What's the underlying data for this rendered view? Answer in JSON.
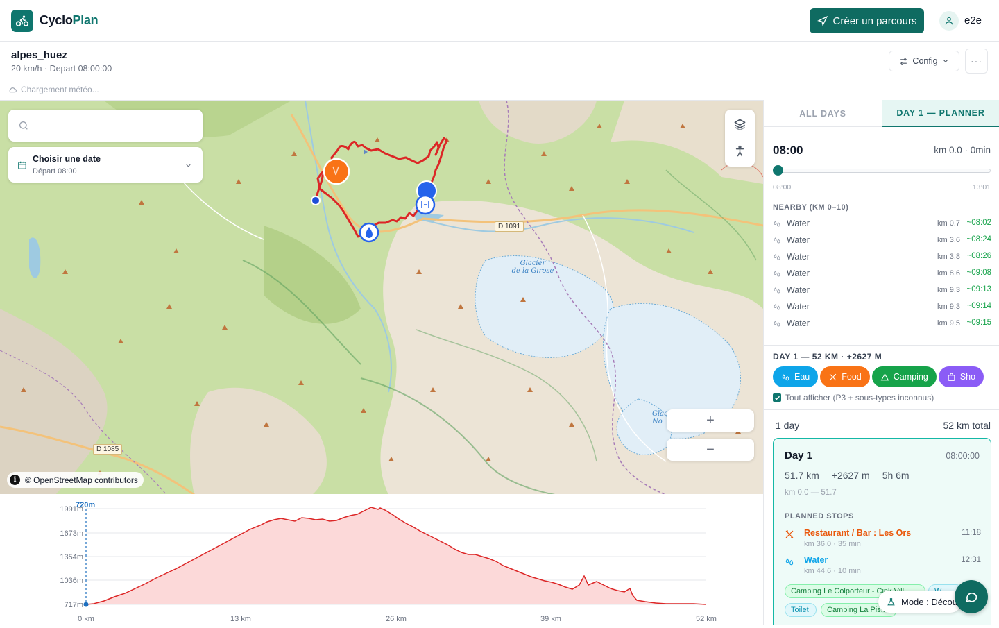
{
  "app": {
    "brand_part1": "Cyclo",
    "brand_part2": "Plan",
    "create_label": "Créer un parcours",
    "username": "e2e"
  },
  "route": {
    "name": "alpes_huez",
    "subtitle": "20 km/h · Depart 08:00:00",
    "weather_status": "Chargement météo...",
    "config_label": "Config",
    "more_label": "···"
  },
  "map": {
    "search_placeholder": "",
    "date_title": "Choisir une date",
    "date_sub": "Départ 08:00",
    "zoom_in": "+",
    "zoom_out": "−",
    "attribution": "© OpenStreetMap contributors",
    "info": "i",
    "labels": {
      "road1": "D 1091",
      "road2": "D 1085",
      "glacier1": "Glacier\nde la Girose",
      "glacier2": "Glac\nNo"
    }
  },
  "elevation": {
    "y_ticks": [
      "1991m",
      "1673m",
      "1354m",
      "1036m",
      "717m"
    ],
    "x_ticks": [
      "0 km",
      "13 km",
      "26 km",
      "39 km",
      "52 km"
    ],
    "cursor_label": "720m"
  },
  "panel": {
    "tabs": [
      {
        "label": "ALL DAYS"
      },
      {
        "label": "DAY 1 — PLANNER"
      }
    ],
    "time": "08:00",
    "km_time": "km 0.0 · 0min",
    "slider_start": "08:00",
    "slider_end": "13:01",
    "nearby_header": "NEARBY (KM 0–10)",
    "nearby": [
      {
        "name": "Water",
        "km": "km 0.7",
        "eta": "~08:02"
      },
      {
        "name": "Water",
        "km": "km 3.6",
        "eta": "~08:24"
      },
      {
        "name": "Water",
        "km": "km 3.8",
        "eta": "~08:26"
      },
      {
        "name": "Water",
        "km": "km 8.6",
        "eta": "~09:08"
      },
      {
        "name": "Water",
        "km": "km 9.3",
        "eta": "~09:13"
      },
      {
        "name": "Water",
        "km": "km 9.3",
        "eta": "~09:14"
      },
      {
        "name": "Water",
        "km": "km 9.5",
        "eta": "~09:15"
      }
    ],
    "day_header": "DAY 1 — 52 KM · +2627 M",
    "chips": [
      {
        "label": "Eau",
        "color": "#0ea5e9"
      },
      {
        "label": "Food",
        "color": "#f97316"
      },
      {
        "label": "Camping",
        "color": "#16a34a"
      },
      {
        "label": "Sho",
        "color": "#8b5cf6"
      }
    ],
    "show_all": "Tout afficher (P3 + sous-types inconnus)",
    "days_count": "1 day",
    "days_total": "52 km total",
    "day_card": {
      "title": "Day 1",
      "start": "08:00:00",
      "distance": "51.7 km",
      "gain": "+2627 m",
      "duration": "5h 6m",
      "range": "km 0.0 — 51.7",
      "stops_header": "PLANNED STOPS",
      "stops": [
        {
          "name": "Restaurant / Bar : Les Ors",
          "detail": "km 36.0 · 35 min",
          "time": "11:18",
          "color": "#ea580c"
        },
        {
          "name": "Water",
          "detail": "km 44.6 · 10 min",
          "time": "12:31",
          "color": "#0ea5e9"
        }
      ],
      "tags": [
        "Camping Le Colporteur - Cink Vill...",
        "W",
        "Toilet",
        "Camping La Pis..."
      ]
    },
    "mode_label": "Mode : Décou"
  }
}
